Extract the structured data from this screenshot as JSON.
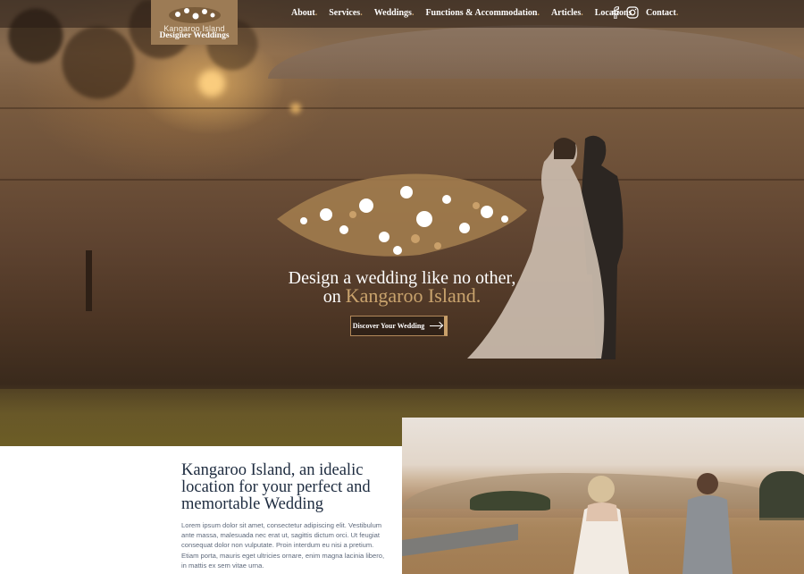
{
  "header": {
    "logo_line1": "Kangaroo Island",
    "logo_line2": "Designer Weddings",
    "nav": [
      {
        "label": "About"
      },
      {
        "label": "Services"
      },
      {
        "label": "Weddings"
      },
      {
        "label": "Functions & Accommodation"
      },
      {
        "label": "Articles"
      },
      {
        "label": "Locations"
      },
      {
        "label": "Contact"
      }
    ],
    "nav_dot": ".",
    "social_icons": [
      "facebook-icon",
      "instagram-icon"
    ]
  },
  "hero": {
    "line1": "Design a wedding like no other,",
    "line2_prefix": "on ",
    "line2_highlight": "Kangaroo Island.",
    "cta_label": "Discover Your Wedding"
  },
  "intro": {
    "title": "Kangaroo Island, an idealic location for your perfect and memortable Wedding",
    "body": "Lorem ipsum dolor sit amet, consectetur adipiscing elit. Vestibulum ante massa, malesuada nec erat ut, sagittis dictum orci. Ut feugiat consequat dolor non vulputate. Proin interdum eu nisi a pretium. Etiam porta, mauris eget ultricies ornare, enim magna lacinia libero, in mattis ex sem vitae urna."
  },
  "colors": {
    "accent_gold": "#c9a36d",
    "logo_bg": "#9c7b55",
    "heading_navy": "#1d2b3f",
    "body_text": "#5f6a7c"
  }
}
